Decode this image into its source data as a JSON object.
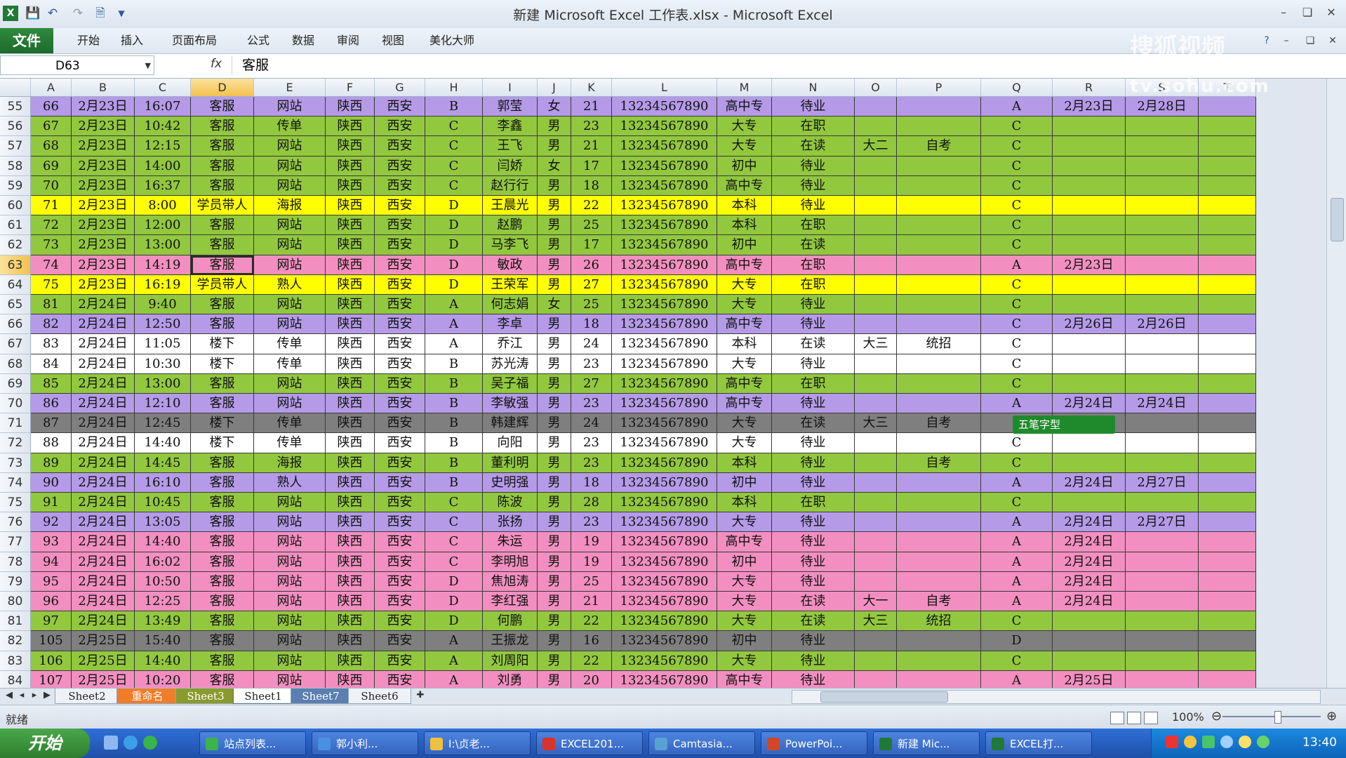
{
  "window": {
    "title": "新建 Microsoft Excel 工作表.xlsx - Microsoft Excel",
    "watermark_main": "搜狐视频",
    "watermark_url": "tv.sohu.com"
  },
  "ribbon": {
    "file_tab": "文件",
    "tabs": [
      "开始",
      "插入",
      "页面布局",
      "公式",
      "数据",
      "审阅",
      "视图",
      "美化大师"
    ]
  },
  "formula_bar": {
    "name_box": "D63",
    "fx": "fx",
    "content": "客服"
  },
  "columns": [
    "A",
    "B",
    "C",
    "D",
    "E",
    "F",
    "G",
    "H",
    "I",
    "J",
    "K",
    "L",
    "M",
    "N",
    "O",
    "P",
    "Q",
    "R",
    "S",
    "T"
  ],
  "selected_column": "D",
  "selected_row": "63",
  "colors": {
    "purple": "#b59ae8",
    "green": "#92c83e",
    "yellow": "#ffff00",
    "pink": "#f28fc0",
    "white": "#ffffff",
    "gray": "#7f7f7f"
  },
  "rows": [
    {
      "row": "55",
      "color": "purple",
      "cells": [
        "66",
        "2月23日",
        "16:07",
        "客服",
        "网站",
        "陕西",
        "西安",
        "B",
        "郭莹",
        "女",
        "21",
        "13234567890",
        "高中专",
        "待业",
        "",
        "",
        "A",
        "2月23日",
        "2月28日",
        ""
      ]
    },
    {
      "row": "56",
      "color": "green",
      "cells": [
        "67",
        "2月23日",
        "10:42",
        "客服",
        "传单",
        "陕西",
        "西安",
        "C",
        "李鑫",
        "男",
        "23",
        "13234567890",
        "大专",
        "在职",
        "",
        "",
        "C",
        "",
        "",
        ""
      ]
    },
    {
      "row": "57",
      "color": "green",
      "cells": [
        "68",
        "2月23日",
        "12:15",
        "客服",
        "网站",
        "陕西",
        "西安",
        "C",
        "王飞",
        "男",
        "21",
        "13234567890",
        "大专",
        "在读",
        "大二",
        "自考",
        "C",
        "",
        "",
        ""
      ]
    },
    {
      "row": "58",
      "color": "green",
      "cells": [
        "69",
        "2月23日",
        "14:00",
        "客服",
        "网站",
        "陕西",
        "西安",
        "C",
        "闫娇",
        "女",
        "17",
        "13234567890",
        "初中",
        "待业",
        "",
        "",
        "C",
        "",
        "",
        ""
      ]
    },
    {
      "row": "59",
      "color": "green",
      "cells": [
        "70",
        "2月23日",
        "16:37",
        "客服",
        "网站",
        "陕西",
        "西安",
        "C",
        "赵行行",
        "男",
        "18",
        "13234567890",
        "高中专",
        "待业",
        "",
        "",
        "C",
        "",
        "",
        ""
      ]
    },
    {
      "row": "60",
      "color": "yellow",
      "cells": [
        "71",
        "2月23日",
        "8:00",
        "学员带人",
        "海报",
        "陕西",
        "西安",
        "D",
        "王晨光",
        "男",
        "22",
        "13234567890",
        "本科",
        "待业",
        "",
        "",
        "C",
        "",
        "",
        ""
      ]
    },
    {
      "row": "61",
      "color": "green",
      "cells": [
        "72",
        "2月23日",
        "12:00",
        "客服",
        "网站",
        "陕西",
        "西安",
        "D",
        "赵鹏",
        "男",
        "25",
        "13234567890",
        "本科",
        "在职",
        "",
        "",
        "C",
        "",
        "",
        ""
      ]
    },
    {
      "row": "62",
      "color": "green",
      "cells": [
        "73",
        "2月23日",
        "13:00",
        "客服",
        "网站",
        "陕西",
        "西安",
        "D",
        "马李飞",
        "男",
        "17",
        "13234567890",
        "初中",
        "在读",
        "",
        "",
        "C",
        "",
        "",
        ""
      ]
    },
    {
      "row": "63",
      "color": "pink",
      "cells": [
        "74",
        "2月23日",
        "14:19",
        "客服",
        "网站",
        "陕西",
        "西安",
        "D",
        "敏政",
        "男",
        "26",
        "13234567890",
        "高中专",
        "在职",
        "",
        "",
        "A",
        "2月23日",
        "",
        ""
      ]
    },
    {
      "row": "64",
      "color": "yellow",
      "cells": [
        "75",
        "2月23日",
        "16:19",
        "学员带人",
        "熟人",
        "陕西",
        "西安",
        "D",
        "王荣军",
        "男",
        "27",
        "13234567890",
        "大专",
        "在职",
        "",
        "",
        "C",
        "",
        "",
        ""
      ]
    },
    {
      "row": "65",
      "color": "green",
      "cells": [
        "81",
        "2月24日",
        "9:40",
        "客服",
        "网站",
        "陕西",
        "西安",
        "A",
        "何志娟",
        "女",
        "25",
        "13234567890",
        "大专",
        "待业",
        "",
        "",
        "C",
        "",
        "",
        ""
      ]
    },
    {
      "row": "66",
      "color": "purple",
      "cells": [
        "82",
        "2月24日",
        "12:50",
        "客服",
        "网站",
        "陕西",
        "西安",
        "A",
        "李卓",
        "男",
        "18",
        "13234567890",
        "高中专",
        "待业",
        "",
        "",
        "C",
        "2月26日",
        "2月26日",
        ""
      ]
    },
    {
      "row": "67",
      "color": "white",
      "cells": [
        "83",
        "2月24日",
        "11:05",
        "楼下",
        "传单",
        "陕西",
        "西安",
        "A",
        "乔江",
        "男",
        "24",
        "13234567890",
        "本科",
        "在读",
        "大三",
        "统招",
        "C",
        "",
        "",
        ""
      ]
    },
    {
      "row": "68",
      "color": "white",
      "cells": [
        "84",
        "2月24日",
        "10:30",
        "楼下",
        "传单",
        "陕西",
        "西安",
        "B",
        "苏光涛",
        "男",
        "23",
        "13234567890",
        "大专",
        "待业",
        "",
        "",
        "C",
        "",
        "",
        ""
      ]
    },
    {
      "row": "69",
      "color": "green",
      "cells": [
        "85",
        "2月24日",
        "13:00",
        "客服",
        "网站",
        "陕西",
        "西安",
        "B",
        "吴子福",
        "男",
        "27",
        "13234567890",
        "高中专",
        "在职",
        "",
        "",
        "C",
        "",
        "",
        ""
      ]
    },
    {
      "row": "70",
      "color": "purple",
      "cells": [
        "86",
        "2月24日",
        "12:10",
        "客服",
        "网站",
        "陕西",
        "西安",
        "B",
        "李敏强",
        "男",
        "23",
        "13234567890",
        "高中专",
        "待业",
        "",
        "",
        "A",
        "2月24日",
        "2月24日",
        ""
      ]
    },
    {
      "row": "71",
      "color": "gray",
      "cells": [
        "87",
        "2月24日",
        "12:45",
        "楼下",
        "传单",
        "陕西",
        "西安",
        "B",
        "韩建辉",
        "男",
        "24",
        "13234567890",
        "大专",
        "在读",
        "大三",
        "自考",
        "",
        "",
        "",
        ""
      ]
    },
    {
      "row": "72",
      "color": "white",
      "cells": [
        "88",
        "2月24日",
        "14:40",
        "楼下",
        "传单",
        "陕西",
        "西安",
        "B",
        "向阳",
        "男",
        "23",
        "13234567890",
        "大专",
        "待业",
        "",
        "",
        "C",
        "",
        "",
        ""
      ]
    },
    {
      "row": "73",
      "color": "green",
      "cells": [
        "89",
        "2月24日",
        "14:45",
        "客服",
        "海报",
        "陕西",
        "西安",
        "B",
        "董利明",
        "男",
        "23",
        "13234567890",
        "本科",
        "待业",
        "",
        "自考",
        "C",
        "",
        "",
        ""
      ]
    },
    {
      "row": "74",
      "color": "purple",
      "cells": [
        "90",
        "2月24日",
        "16:10",
        "客服",
        "熟人",
        "陕西",
        "西安",
        "B",
        "史明强",
        "男",
        "18",
        "13234567890",
        "初中",
        "待业",
        "",
        "",
        "A",
        "2月24日",
        "2月27日",
        ""
      ]
    },
    {
      "row": "75",
      "color": "green",
      "cells": [
        "91",
        "2月24日",
        "10:45",
        "客服",
        "网站",
        "陕西",
        "西安",
        "C",
        "陈波",
        "男",
        "28",
        "13234567890",
        "本科",
        "在职",
        "",
        "",
        "C",
        "",
        "",
        ""
      ]
    },
    {
      "row": "76",
      "color": "purple",
      "cells": [
        "92",
        "2月24日",
        "13:05",
        "客服",
        "网站",
        "陕西",
        "西安",
        "C",
        "张扬",
        "男",
        "23",
        "13234567890",
        "大专",
        "待业",
        "",
        "",
        "A",
        "2月24日",
        "2月27日",
        ""
      ]
    },
    {
      "row": "77",
      "color": "pink",
      "cells": [
        "93",
        "2月24日",
        "14:40",
        "客服",
        "网站",
        "陕西",
        "西安",
        "C",
        "朱运",
        "男",
        "19",
        "13234567890",
        "高中专",
        "待业",
        "",
        "",
        "A",
        "2月24日",
        "",
        ""
      ]
    },
    {
      "row": "78",
      "color": "pink",
      "cells": [
        "94",
        "2月24日",
        "16:02",
        "客服",
        "网站",
        "陕西",
        "西安",
        "C",
        "李明旭",
        "男",
        "19",
        "13234567890",
        "初中",
        "待业",
        "",
        "",
        "A",
        "2月24日",
        "",
        ""
      ]
    },
    {
      "row": "79",
      "color": "pink",
      "cells": [
        "95",
        "2月24日",
        "10:50",
        "客服",
        "网站",
        "陕西",
        "西安",
        "D",
        "焦旭涛",
        "男",
        "25",
        "13234567890",
        "大专",
        "待业",
        "",
        "",
        "A",
        "2月24日",
        "",
        ""
      ]
    },
    {
      "row": "80",
      "color": "pink",
      "cells": [
        "96",
        "2月24日",
        "12:25",
        "客服",
        "网站",
        "陕西",
        "西安",
        "D",
        "李红强",
        "男",
        "21",
        "13234567890",
        "大专",
        "在读",
        "大一",
        "自考",
        "A",
        "2月24日",
        "",
        ""
      ]
    },
    {
      "row": "81",
      "color": "green",
      "cells": [
        "97",
        "2月24日",
        "13:49",
        "客服",
        "网站",
        "陕西",
        "西安",
        "D",
        "何鹏",
        "男",
        "22",
        "13234567890",
        "大专",
        "在读",
        "大三",
        "统招",
        "C",
        "",
        "",
        ""
      ]
    },
    {
      "row": "82",
      "color": "gray",
      "cells": [
        "105",
        "2月25日",
        "15:40",
        "客服",
        "网站",
        "陕西",
        "西安",
        "A",
        "王振龙",
        "男",
        "16",
        "13234567890",
        "初中",
        "待业",
        "",
        "",
        "D",
        "",
        "",
        ""
      ]
    },
    {
      "row": "83",
      "color": "green",
      "cells": [
        "106",
        "2月25日",
        "14:40",
        "客服",
        "网站",
        "陕西",
        "西安",
        "A",
        "刘周阳",
        "男",
        "22",
        "13234567890",
        "大专",
        "待业",
        "",
        "",
        "C",
        "",
        "",
        ""
      ]
    },
    {
      "row": "84",
      "color": "pink",
      "cells": [
        "107",
        "2月25日",
        "10:20",
        "客服",
        "网站",
        "陕西",
        "西安",
        "A",
        "刘勇",
        "男",
        "20",
        "13234567890",
        "高中专",
        "待业",
        "",
        "",
        "A",
        "2月25日",
        "",
        ""
      ]
    }
  ],
  "ime_popup": "五笔字型",
  "sheet_tabs": [
    {
      "label": "Sheet2",
      "style": "plain"
    },
    {
      "label": "重命名",
      "style": "orange"
    },
    {
      "label": "Sheet3",
      "style": "olive"
    },
    {
      "label": "Sheet1",
      "style": "active"
    },
    {
      "label": "Sheet7",
      "style": "blue"
    },
    {
      "label": "Sheet6",
      "style": "plain"
    }
  ],
  "status": {
    "ready": "就绪",
    "zoom": "100%"
  },
  "taskbar": {
    "start": "开始",
    "tasks": [
      "站点列表...",
      "郭小利...",
      "I:\\贞老...",
      "EXCEL201...",
      "Camtasia...",
      "PowerPoi...",
      "新建 Mic...",
      "EXCEL打..."
    ],
    "clock": "13:40"
  }
}
